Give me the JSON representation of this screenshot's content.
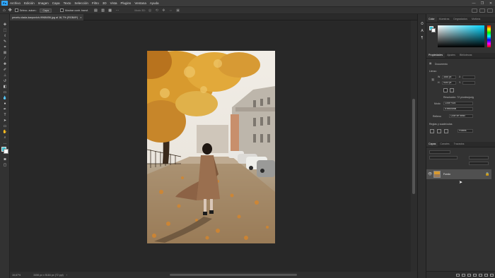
{
  "menubar": {
    "app_logo": "Ps",
    "items": [
      "Archivo",
      "Edición",
      "Imagen",
      "Capa",
      "Texto",
      "Selección",
      "Filtro",
      "3D",
      "Vista",
      "Plugins",
      "Ventana",
      "Ayuda"
    ]
  },
  "options": {
    "autoselect_label": "Selecc. autom.:",
    "autoselect_value": "Capa",
    "show_transform": "Mostrar contr. transf.",
    "mode_3d": "Modo 3D:"
  },
  "document": {
    "tab_title": "pexels-vlada-karpovich-9968456.jpg al 16,7% (RGB/8*)",
    "tab_close": "×"
  },
  "status": {
    "zoom": "16,67%",
    "dimensions": "3456 px x 5184 px (72 ppi)"
  },
  "color_panel": {
    "tabs": [
      "Color",
      "Muestras",
      "Degradados",
      "Motivos"
    ],
    "accent": "#3ac1d1"
  },
  "properties_panel": {
    "tabs": [
      "Propiedades",
      "Ajustes",
      "Bibliotecas"
    ],
    "document_label": "Documento",
    "canvas_section": "Lienzo",
    "width": "3456 px",
    "height": "5184 px",
    "x_label": "X",
    "y_label": "Y",
    "resolution": "Resolución: 72 píxeles/pulg",
    "mode_label": "Modo",
    "mode_value": "Color RGB",
    "depth_value": "8 bits/canal",
    "fill_label": "Relleno",
    "fill_value": "Color de fondo",
    "guides_section": "Reglas y cuadrículas",
    "guides_unit": "Píxeles"
  },
  "layers_panel": {
    "tabs": [
      "Capas",
      "Canales",
      "Trazados"
    ],
    "layer_name": "Fondo"
  },
  "window_controls": [
    "—",
    "❐",
    "✕"
  ]
}
